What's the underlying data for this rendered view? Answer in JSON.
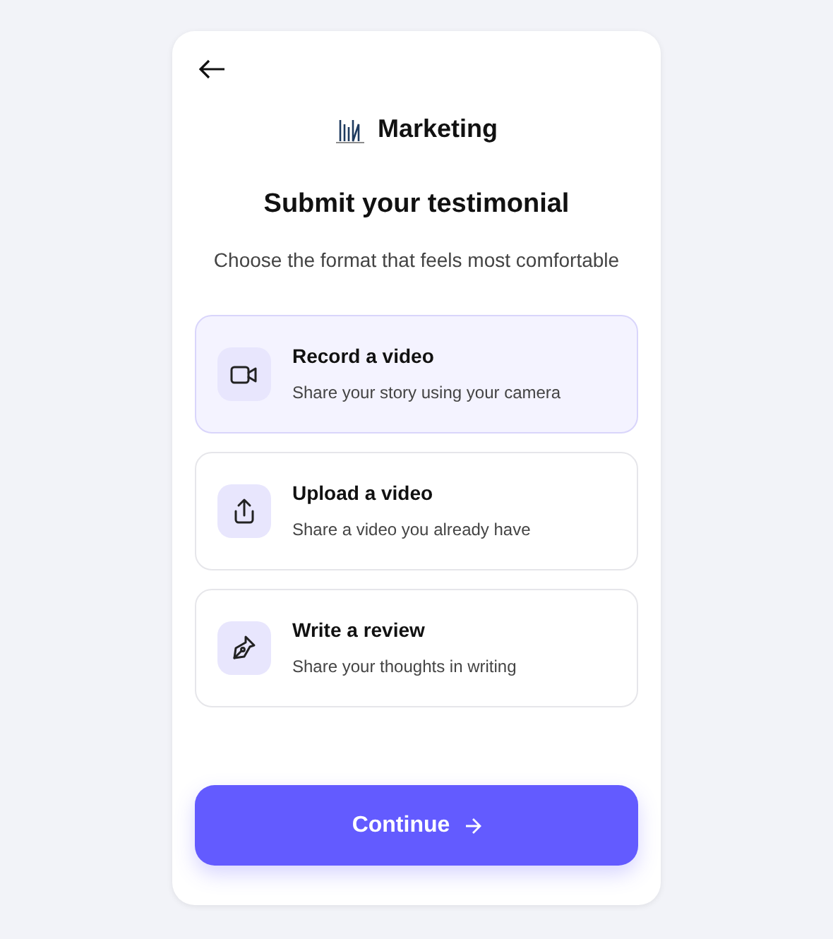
{
  "brand": {
    "name": "Marketing"
  },
  "title": "Submit your testimonial",
  "subtitle": "Choose the format that feels most comfortable",
  "options": [
    {
      "kind": "record",
      "title": "Record a video",
      "description": "Share your story using your camera",
      "selected": true
    },
    {
      "kind": "upload",
      "title": "Upload a video",
      "description": "Share a video you already have",
      "selected": false
    },
    {
      "kind": "write",
      "title": "Write a review",
      "description": "Share your thoughts in writing",
      "selected": false
    }
  ],
  "continue_button": {
    "label": "Continue"
  }
}
